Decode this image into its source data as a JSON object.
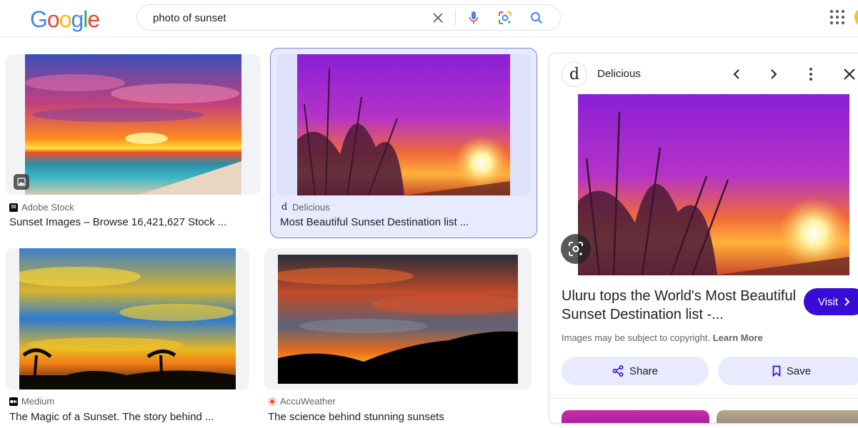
{
  "header": {
    "logo_letters": [
      "G",
      "o",
      "o",
      "g",
      "l",
      "e"
    ],
    "logo_colors": [
      "#4285F4",
      "#EA4335",
      "#FBBC05",
      "#4285F4",
      "#34A853",
      "#EA4335"
    ],
    "search_value": "photo of sunset",
    "icons": [
      "clear-icon",
      "voice-search-icon",
      "lens-icon",
      "search-icon",
      "apps-grid-icon"
    ]
  },
  "results": [
    {
      "source": "Adobe Stock",
      "caption": "Sunset Images – Browse 16,421,627 Stock ...",
      "source_icon": "St",
      "source_color": "#0b0b0b"
    },
    {
      "source": "Delicious",
      "caption": "Most Beautiful Sunset Destination list ...",
      "source_icon": "d",
      "source_color": "#202124"
    },
    {
      "source": "Medium",
      "caption": "The Magic of a Sunset. The story behind ...",
      "source_icon": "medium-icon",
      "source_color": "#000000"
    },
    {
      "source": "AccuWeather",
      "caption": "The science behind stunning sunsets",
      "source_icon": "accuweather-icon",
      "source_color": "#f05514"
    }
  ],
  "panel": {
    "site_logo": "d",
    "site_name": "Delicious",
    "title": "Uluru tops the World's Most Beautiful Sunset Destination list -...",
    "visit_label": "Visit",
    "copyright_text": "Images may be subject to copyright.",
    "learn_more": "Learn More",
    "share_label": "Share",
    "save_label": "Save",
    "accent": "#3a0bd6"
  }
}
